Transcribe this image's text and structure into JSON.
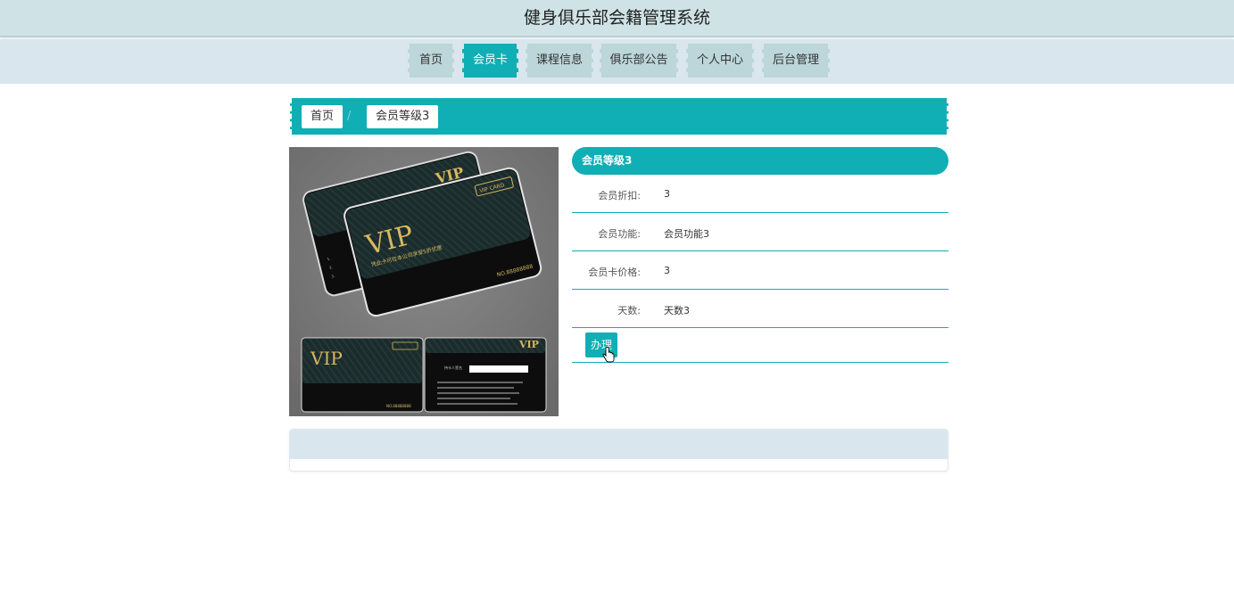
{
  "header": {
    "title": "健身俱乐部会籍管理系统"
  },
  "nav": [
    {
      "label": "首页",
      "active": false
    },
    {
      "label": "会员卡",
      "active": true
    },
    {
      "label": "课程信息",
      "active": false
    },
    {
      "label": "俱乐部公告",
      "active": false
    },
    {
      "label": "个人中心",
      "active": false
    },
    {
      "label": "后台管理",
      "active": false
    }
  ],
  "breadcrumb": {
    "home": "首页",
    "separator": "/",
    "current": "会员等级3"
  },
  "card_image": {
    "big_card_brand": "VIP",
    "big_card_subtitle": "凭此卡可在本公司享受5折优惠",
    "big_card_no": "NO.88888888",
    "back_card_label": "VIP",
    "back_card_tag": "VIP CARD",
    "small_front_brand": "VIP",
    "small_front_no": "NO.88888888",
    "small_back_brand": "VIP",
    "small_back_signature_label": "持卡人签名"
  },
  "detail": {
    "title": "会员等级3",
    "fields": [
      {
        "label": "会员折扣:",
        "value": "3"
      },
      {
        "label": "会员功能:",
        "value": "会员功能3"
      },
      {
        "label": "会员卡价格:",
        "value": "3"
      },
      {
        "label": "天数:",
        "value": "天数3"
      }
    ],
    "action_label": "办理"
  },
  "colors": {
    "accent": "#10aeb5",
    "header_bg": "#cfe3e6",
    "nav_bg": "#d9e6ee",
    "nav_item_bg": "#bcd6da"
  }
}
